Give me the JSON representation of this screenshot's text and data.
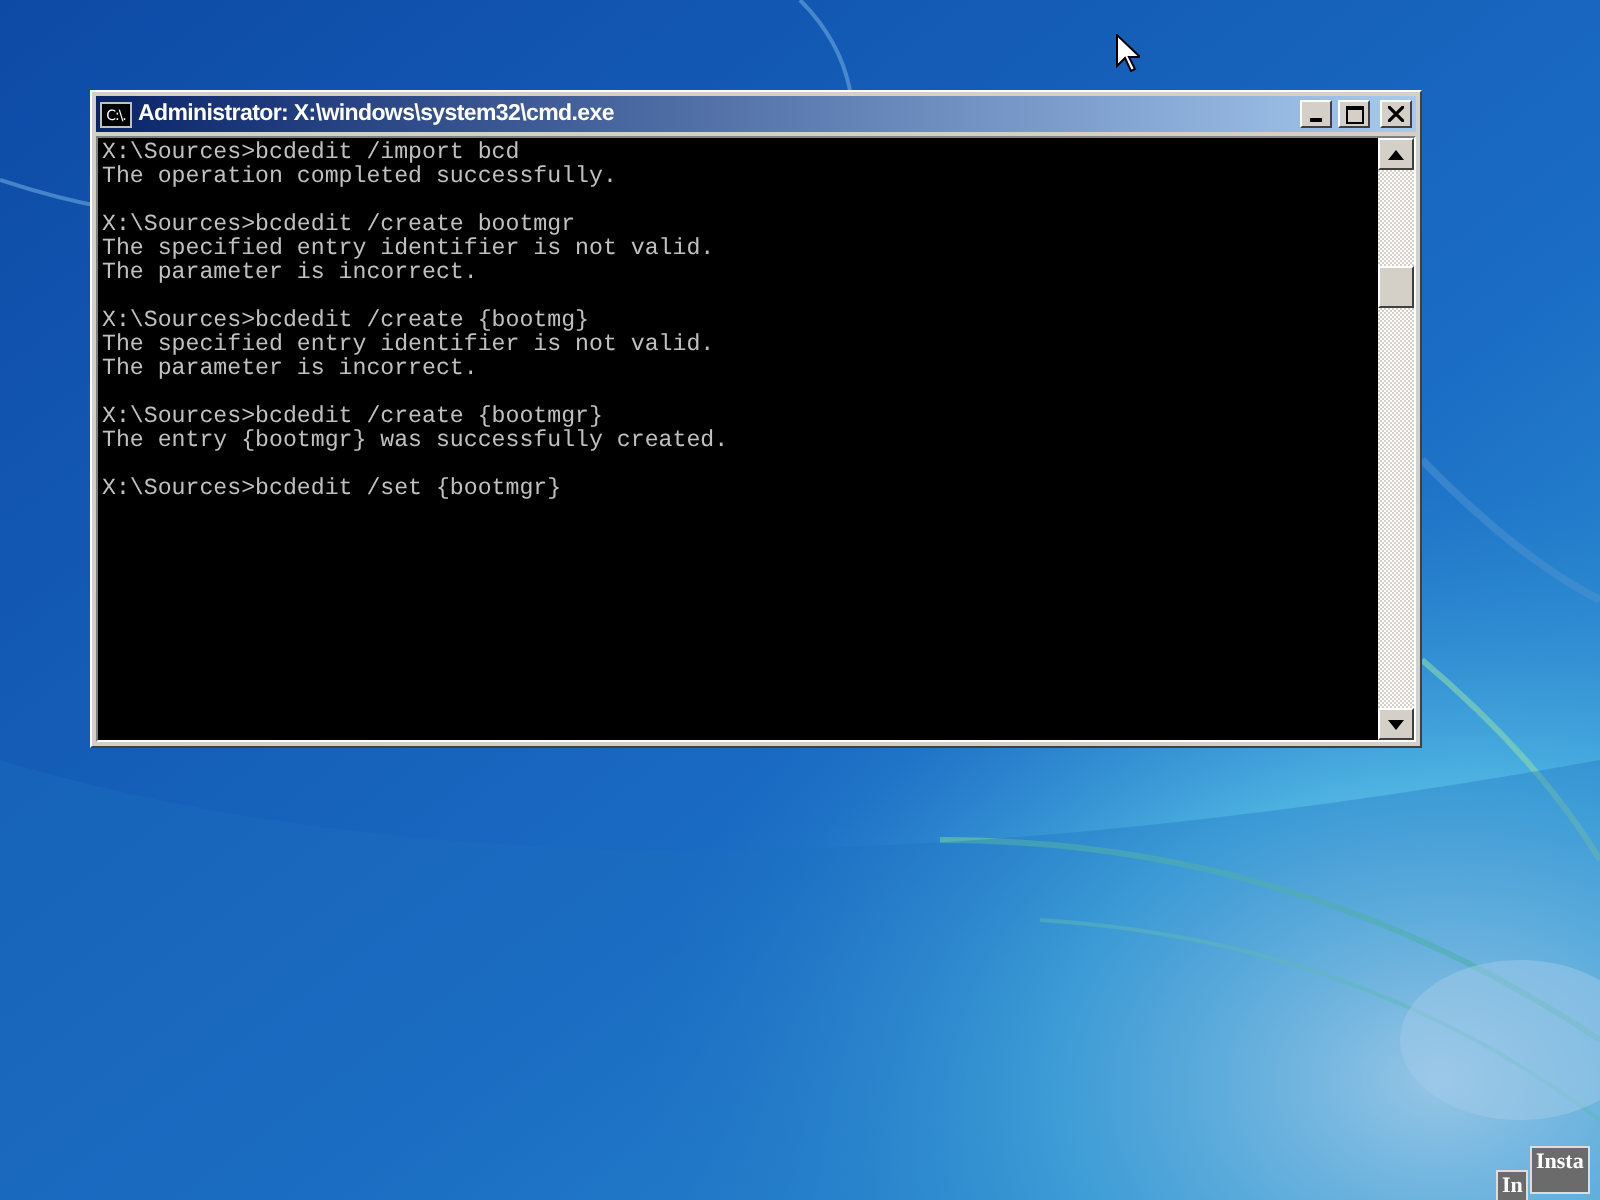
{
  "window": {
    "title": "Administrator: X:\\windows\\system32\\cmd.exe",
    "icon_text": "C:\\."
  },
  "console": {
    "blocks": [
      [
        "X:\\Sources>bcdedit /import bcd",
        "The operation completed successfully."
      ],
      [
        "X:\\Sources>bcdedit /create bootmgr",
        "The specified entry identifier is not valid.",
        "The parameter is incorrect."
      ],
      [
        "X:\\Sources>bcdedit /create {bootmg}",
        "The specified entry identifier is not valid.",
        "The parameter is incorrect."
      ],
      [
        "X:\\Sources>bcdedit /create {bootmgr}",
        "The entry {bootmgr} was successfully created."
      ],
      [
        "X:\\Sources>bcdedit /set {bootmgr}"
      ]
    ]
  },
  "background_windows": [
    {
      "title": "In"
    },
    {
      "title": "Insta"
    }
  ]
}
